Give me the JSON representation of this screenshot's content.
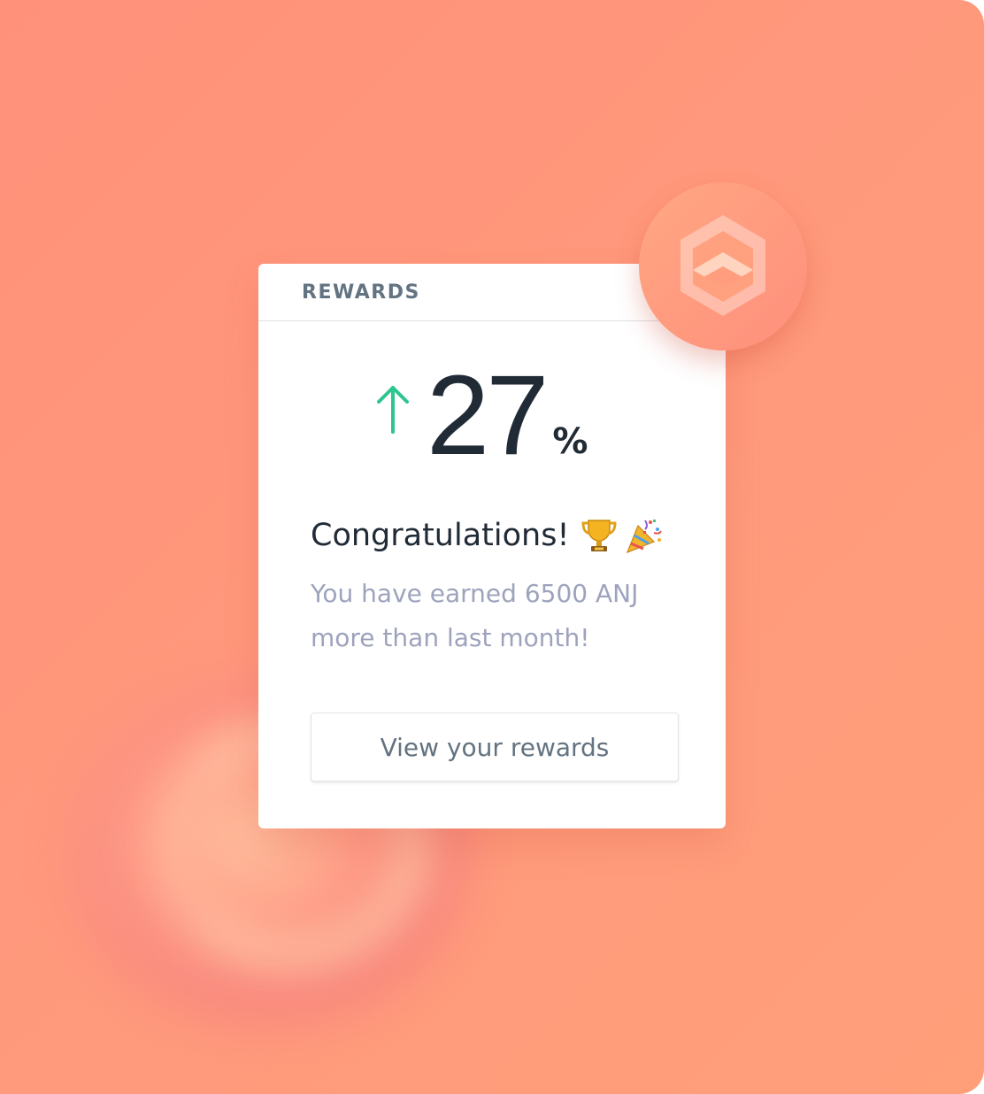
{
  "card": {
    "title": "REWARDS",
    "stat_value": "27",
    "stat_unit": "%",
    "headline": "Congratulations!",
    "message_line1": "You have earned 6500 ANJ",
    "message_line2": "more than last month!",
    "button_label": "View your rewards"
  },
  "icons": {
    "trend": "arrow-up-icon",
    "headline_emojis": [
      "trophy-icon",
      "party-popper-icon"
    ],
    "badge": "hexagon-logo-icon"
  },
  "colors": {
    "background": "#ff9a7c",
    "trend_up": "#2cc68f",
    "text_dark": "#212b36",
    "text_muted": "#9ea3bd",
    "header_text": "#637381"
  }
}
